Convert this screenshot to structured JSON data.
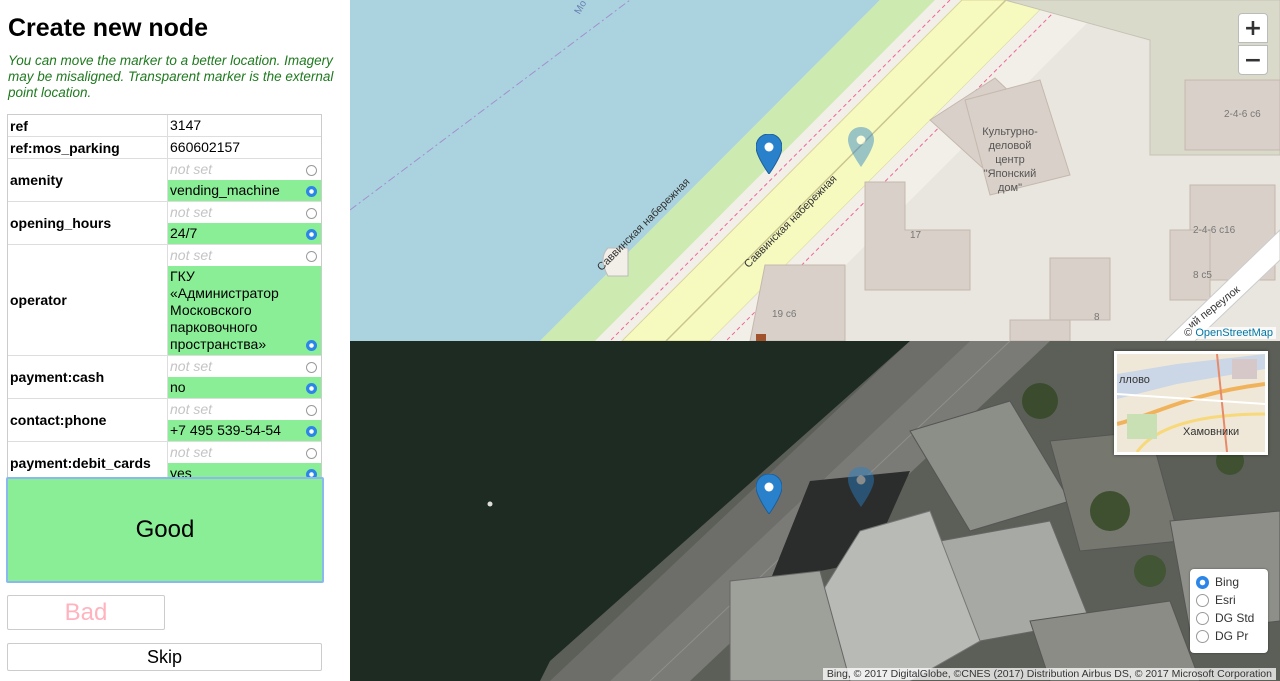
{
  "panel": {
    "title": "Create new node",
    "hint": "You can move the marker to a better location. Imagery may be misaligned. Transparent marker is the external point location.",
    "not_set": "not set",
    "tags": [
      {
        "key": "ref",
        "value": "3147"
      },
      {
        "key": "ref:mos_parking",
        "value": "660602157"
      },
      {
        "key": "amenity",
        "value": "vending_machine"
      },
      {
        "key": "opening_hours",
        "value": "24/7"
      },
      {
        "key": "operator",
        "value": "ГКУ «Администратор Московского парковочного пространства»"
      },
      {
        "key": "payment:cash",
        "value": "no"
      },
      {
        "key": "contact:phone",
        "value": "+7 495 539-54-54"
      },
      {
        "key": "payment:debit_cards",
        "value": "yes"
      }
    ],
    "buttons": {
      "good": "Good",
      "bad": "Bad",
      "skip": "Skip"
    }
  },
  "map": {
    "zoom_in": "+",
    "zoom_out": "−",
    "labels": {
      "building_center": "Культурно-\nделовой\nцентр\n\"Японский\nдом\"",
      "street1": "Саввинская набережная",
      "street2": "Саввинская набережная",
      "street_lane": "ий переулок",
      "house_17": "17",
      "house_19c6": "19 с6",
      "house_8": "8",
      "house_8c5": "8 с5",
      "house_246c6a": "2-4-6 с6",
      "house_246c6b": "2-4-6 с16",
      "river_label": "Мо"
    },
    "attribution_osm_prefix": "© ",
    "attribution_osm_link": "OpenStreetMap",
    "minimap_label_district": "Хамовники",
    "minimap_label_edge": "ллово",
    "attribution_bing": "Bing, © 2017 DigitalGlobe, ©CNES (2017) Distribution Airbus DS, © 2017 Microsoft Corporation",
    "layers": [
      {
        "label": "Bing",
        "selected": true
      },
      {
        "label": "Esri",
        "selected": false
      },
      {
        "label": "DG Std",
        "selected": false
      },
      {
        "label": "DG Pr",
        "selected": false
      }
    ]
  },
  "colors": {
    "accent": "#2c86e8",
    "selected_bg": "#8aee96",
    "hint_text": "#1f7a1f",
    "bad_text": "#ffb3be"
  }
}
